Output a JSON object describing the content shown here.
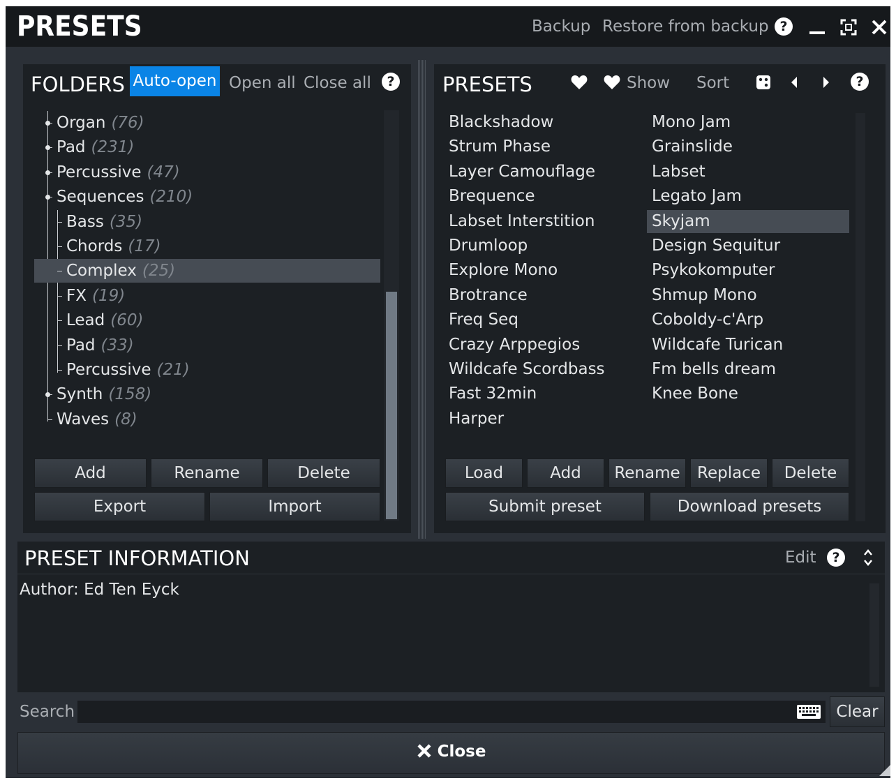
{
  "header": {
    "title": "PRESETS",
    "backup": "Backup",
    "restore": "Restore from backup",
    "help": "?"
  },
  "folders": {
    "title": "FOLDERS",
    "auto_open": "Auto-open",
    "open_all": "Open all",
    "close_all": "Close all",
    "help": "?",
    "tree": [
      {
        "name": "Organ",
        "count": "(76)",
        "level": 0,
        "expander": true
      },
      {
        "name": "Pad",
        "count": "(231)",
        "level": 0,
        "expander": true
      },
      {
        "name": "Percussive",
        "count": "(47)",
        "level": 0,
        "expander": true
      },
      {
        "name": "Sequences",
        "count": "(210)",
        "level": 0,
        "expander": true
      },
      {
        "name": "Bass",
        "count": "(35)",
        "level": 1
      },
      {
        "name": "Chords",
        "count": "(17)",
        "level": 1
      },
      {
        "name": "Complex",
        "count": "(25)",
        "level": 1,
        "selected": true
      },
      {
        "name": "FX",
        "count": "(19)",
        "level": 1
      },
      {
        "name": "Lead",
        "count": "(60)",
        "level": 1
      },
      {
        "name": "Pad",
        "count": "(33)",
        "level": 1
      },
      {
        "name": "Percussive",
        "count": "(21)",
        "level": 1
      },
      {
        "name": "Synth",
        "count": "(158)",
        "level": 0,
        "expander": true
      },
      {
        "name": "Waves",
        "count": "(8)",
        "level": 0
      }
    ],
    "buttons": {
      "add": "Add",
      "rename": "Rename",
      "delete": "Delete",
      "export": "Export",
      "import": "Import"
    }
  },
  "presets": {
    "title": "PRESETS",
    "show": "Show",
    "sort": "Sort",
    "help": "?",
    "col1": [
      "Blackshadow",
      "Strum Phase",
      "Layer Camouflage",
      "Brequence",
      "Labset Interstition",
      "Drumloop",
      "Explore Mono",
      "Brotrance",
      "Freq Seq",
      "Crazy Arppegios",
      "Wildcafe Scordbass",
      "Fast 32min",
      "Harper"
    ],
    "col2": [
      "Mono Jam",
      "Grainslide",
      "Labset",
      "Legato Jam",
      "Skyjam",
      "Design Sequitur",
      "Psykokomputer",
      "Shmup Mono",
      "Coboldy-c'Arp",
      "Wildcafe Turican",
      "Fm bells dream",
      "Knee Bone"
    ],
    "selected": "Skyjam",
    "buttons": {
      "load": "Load",
      "add": "Add",
      "rename": "Rename",
      "replace": "Replace",
      "delete": "Delete",
      "submit": "Submit preset",
      "download": "Download presets"
    }
  },
  "info": {
    "title": "PRESET INFORMATION",
    "edit": "Edit",
    "help": "?",
    "text": "Author: Ed Ten Eyck"
  },
  "search": {
    "label": "Search",
    "value": "",
    "clear": "Clear"
  },
  "footer": {
    "close": "Close"
  }
}
